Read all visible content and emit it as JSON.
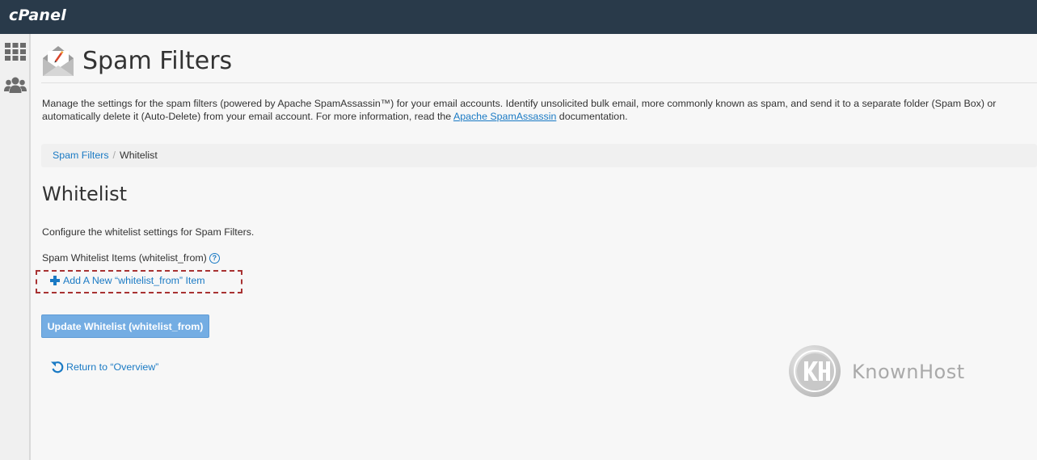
{
  "app": {
    "logo_text": "cPanel"
  },
  "sidebar": {
    "items": [
      {
        "icon": "grid-icon"
      },
      {
        "icon": "users-icon"
      }
    ]
  },
  "page": {
    "title": "Spam Filters",
    "icon": "spam-filters-icon",
    "description_before_link": "Manage the settings for the spam filters (powered by Apache SpamAssassin™) for your email accounts. Identify unsolicited bulk email, more commonly known as spam, and send it to a separate folder (Spam Box) or automatically delete it (Auto-Delete) from your email account. For more information, read the ",
    "description_link": "Apache SpamAssassin",
    "description_after_link": " documentation."
  },
  "breadcrumb": {
    "parent": "Spam Filters",
    "separator": "/",
    "current": "Whitelist"
  },
  "whitelist": {
    "title": "Whitelist",
    "description": "Configure the whitelist settings for Spam Filters.",
    "items_label": "Spam Whitelist Items (whitelist_from)",
    "help_glyph": "?",
    "add_label": "Add A New “whitelist_from” Item",
    "update_button": "Update Whitelist (whitelist_from)",
    "return_label": "Return to “Overview”"
  },
  "watermark": {
    "text": "KnownHost"
  },
  "colors": {
    "topbar": "#293a4a",
    "link": "#1a7ac4",
    "button": "#74ade3",
    "highlight_border": "#a83232"
  }
}
